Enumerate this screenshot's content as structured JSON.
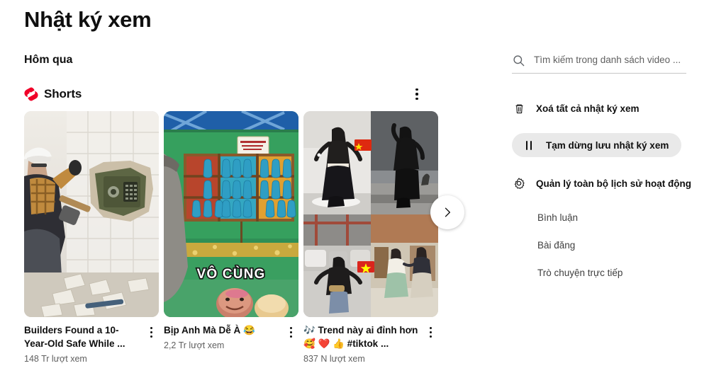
{
  "page": {
    "title": "Nhật ký xem",
    "date_section": "Hôm qua"
  },
  "shelf": {
    "label": "Shorts",
    "logo_icon": "youtube-shorts-icon",
    "menu_icon": "more-vertical-icon",
    "next_icon": "chevron-right-icon"
  },
  "videos": [
    {
      "title": "Builders Found a 10-Year-Old Safe While ...",
      "views": "148 Tr lượt xem",
      "thumbnail": "builder-breaking-tiled-wall-revealing-green-safe",
      "menu_icon": "more-vertical-icon"
    },
    {
      "title": "Bịp Anh Mà Dễ À 😂",
      "views": "2,2 Tr lượt xem",
      "thumbnail": "carnival-booth-with-blue-bottles-vo-cung-caption",
      "caption": "VÔ CÙNG",
      "menu_icon": "more-vertical-icon"
    },
    {
      "title": "🎶 Trend này ai đỉnh hơn🥰 ❤️ 👍 #tiktok ...",
      "views": "837 N lượt xem",
      "thumbnail": "four-panel-dance-collage-with-china-and-vietnam-flags",
      "menu_icon": "more-vertical-icon"
    }
  ],
  "sidebar": {
    "search": {
      "placeholder": "Tìm kiếm trong danh sách video ...",
      "value": "",
      "icon": "search-icon"
    },
    "actions": [
      {
        "label": "Xoá tất cả nhật ký xem",
        "icon": "trash-icon"
      },
      {
        "label": "Tạm dừng lưu nhật ký xem",
        "icon": "pause-icon"
      },
      {
        "label": "Quản lý toàn bộ lịch sử hoạt động",
        "icon": "gear-icon"
      }
    ],
    "links": [
      {
        "label": "Bình luận"
      },
      {
        "label": "Bài đăng"
      },
      {
        "label": "Trò chuyện trực tiếp"
      }
    ]
  },
  "colors": {
    "shorts_red": "#f00028",
    "text_primary": "#0f0f0f",
    "text_secondary": "#606060",
    "chip_bg": "#e9e9e9"
  }
}
